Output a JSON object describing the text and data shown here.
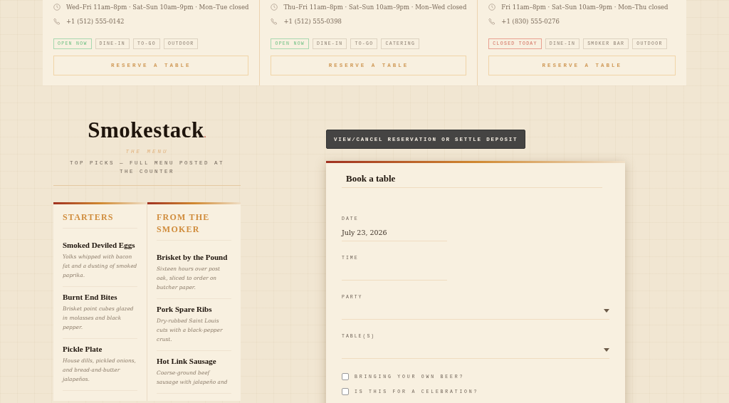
{
  "locations": [
    {
      "hours": "Wed–Fri 11am–8pm · Sat–Sun 10am–9pm · Mon–Tue closed",
      "phone": "+1 (512) 555-0142",
      "tags": [
        {
          "label": "OPEN NOW",
          "kind": "open"
        },
        {
          "label": "DINE-IN",
          "kind": "feature"
        },
        {
          "label": "TO-GO",
          "kind": "feature"
        },
        {
          "label": "OUTDOOR",
          "kind": "feature"
        }
      ],
      "button": "RESERVE A TABLE"
    },
    {
      "hours": "Thu–Fri 11am–8pm · Sat–Sun 10am–9pm · Mon–Wed closed",
      "phone": "+1 (512) 555-0398",
      "tags": [
        {
          "label": "OPEN NOW",
          "kind": "open"
        },
        {
          "label": "DINE-IN",
          "kind": "feature"
        },
        {
          "label": "TO-GO",
          "kind": "feature"
        },
        {
          "label": "CATERING",
          "kind": "feature"
        }
      ],
      "button": "RESERVE A TABLE"
    },
    {
      "hours": "Fri 11am–8pm · Sat–Sun 10am–9pm · Mon–Thu closed",
      "phone": "+1 (830) 555-0276",
      "tags": [
        {
          "label": "CLOSED TODAY",
          "kind": "closed"
        },
        {
          "label": "DINE-IN",
          "kind": "feature"
        },
        {
          "label": "SMOKER BAR",
          "kind": "feature"
        },
        {
          "label": "OUTDOOR",
          "kind": "feature"
        }
      ],
      "button": "RESERVE A TABLE"
    }
  ],
  "menu": {
    "title": "Smokestack",
    "title_mark": ".",
    "kicker": "THE MENU",
    "subtitle": "TOP PICKS — FULL MENU POSTED AT THE COUNTER",
    "sections": [
      {
        "heading": "STARTERS",
        "items": [
          {
            "name": "Smoked Deviled Eggs",
            "description": "Yolks whipped with bacon fat and a dusting of smoked paprika."
          },
          {
            "name": "Burnt End Bites",
            "description": "Brisket point cubes glazed in molasses and black pepper."
          },
          {
            "name": "Pickle Plate",
            "description": "House dills, pickled onions, and bread-and-butter jalapeños."
          }
        ]
      },
      {
        "heading": "FROM THE SMOKER",
        "items": [
          {
            "name": "Brisket by the Pound",
            "description": "Sixteen hours over post oak, sliced to order on butcher paper."
          },
          {
            "name": "Pork Spare Ribs",
            "description": "Dry-rubbed Saint Louis cuts with a black-pepper crust."
          },
          {
            "name": "Hot Link Sausage",
            "description": "Coarse-ground beef sausage with jalapeño and"
          }
        ]
      }
    ]
  },
  "reservation_button": "VIEW/CANCEL RESERVATION OR SETTLE DEPOSIT",
  "booking": {
    "title": "Book a table",
    "fields": [
      {
        "label": "DATE",
        "kind": "text",
        "value": "July 23, 2026"
      },
      {
        "label": "TIME",
        "kind": "text"
      },
      {
        "label": "PARTY",
        "kind": "select"
      },
      {
        "label": "TABLE(S)",
        "kind": "select"
      }
    ],
    "options": [
      {
        "label": "BRINGING YOUR OWN BEER?",
        "checked": false
      },
      {
        "label": "IS THIS FOR A CELEBRATION?",
        "checked": false
      }
    ]
  }
}
